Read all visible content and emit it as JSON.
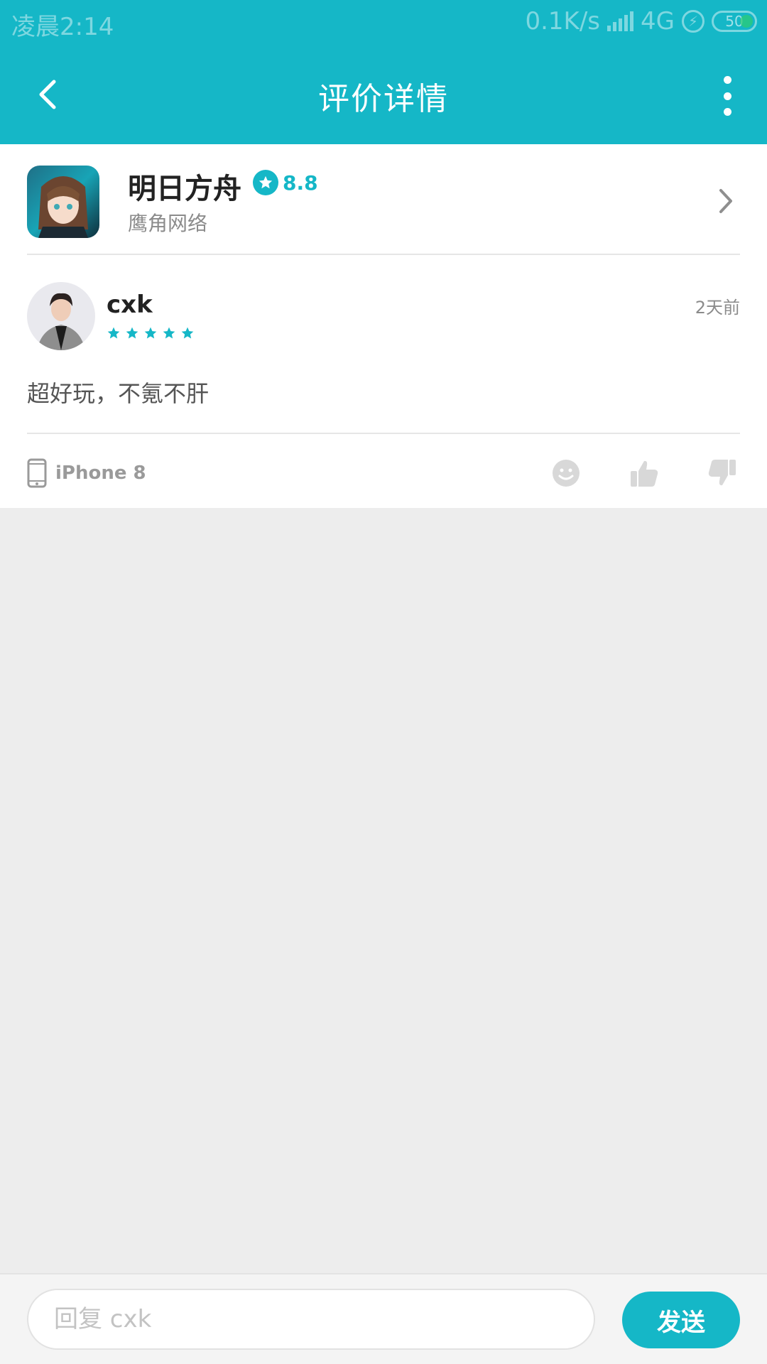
{
  "status_bar": {
    "time": "凌晨2:14",
    "speed": "0.1K/s",
    "network": "4G",
    "battery": "50"
  },
  "header": {
    "title": "评价详情"
  },
  "game": {
    "name": "明日方舟",
    "score": "8.8",
    "developer": "鹰角网络"
  },
  "review": {
    "username": "cxk",
    "stars": 5,
    "date": "2天前",
    "content": "超好玩，不氪不肝",
    "device": "iPhone 8"
  },
  "reply": {
    "placeholder": "回复 cxk",
    "send_label": "发送"
  },
  "colors": {
    "accent": "#15b7c7",
    "background": "#ededed"
  },
  "icons": [
    "back-arrow-icon",
    "more-vertical-icon",
    "star-icon",
    "chevron-right-icon",
    "phone-icon",
    "smiley-icon",
    "thumbs-up-icon",
    "thumbs-down-icon"
  ]
}
